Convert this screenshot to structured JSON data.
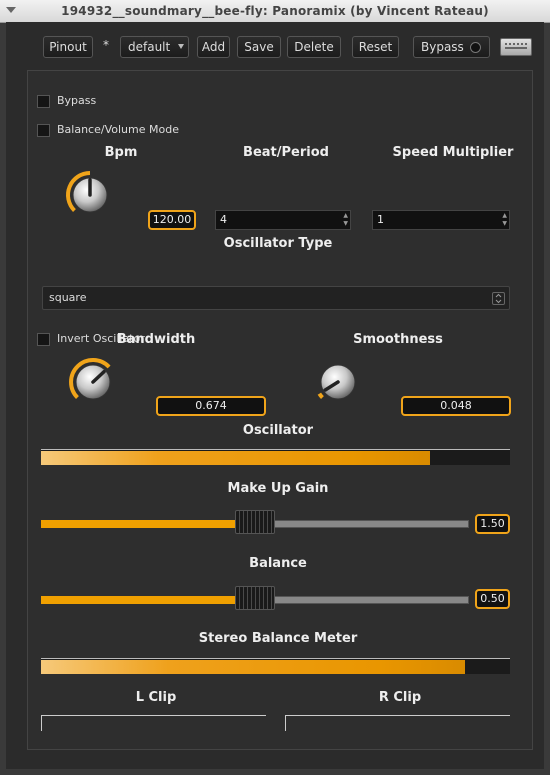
{
  "window": {
    "title": "194932__soundmary__bee-fly: Panoramix (by Vincent Rateau)"
  },
  "toolbar": {
    "pinout": "Pinout",
    "modified_marker": "*",
    "preset": "default",
    "add": "Add",
    "save": "Save",
    "delete": "Delete",
    "reset": "Reset",
    "bypass": "Bypass"
  },
  "controls": {
    "bypass_label": "Bypass",
    "bypass_checked": false,
    "balance_volume_mode_label": "Balance/Volume Mode",
    "balance_volume_mode_checked": false,
    "bpm_label": "Bpm",
    "bpm_value": "120.00",
    "bpm_level": 0.5,
    "beat_period_label": "Beat/Period",
    "beat_period_value": "4",
    "speed_multiplier_label": "Speed Multiplier",
    "speed_multiplier_value": "1",
    "oscillator_type_label": "Oscillator Type",
    "oscillator_type_value": "square",
    "invert_oscillator_label": "Invert Oscillator",
    "invert_oscillator_checked": false,
    "bandwidth_label": "Bandwidth",
    "bandwidth_value": "0.674",
    "bandwidth_level": 0.674,
    "smoothness_label": "Smoothness",
    "smoothness_value": "0.048",
    "smoothness_level": 0.048,
    "oscillator_label": "Oscillator",
    "oscillator_level": 0.83,
    "make_up_gain_label": "Make Up Gain",
    "make_up_gain_value": "1.50",
    "make_up_gain_level": 0.5,
    "balance_label": "Balance",
    "balance_value": "0.50",
    "balance_level": 0.5,
    "stereo_balance_meter_label": "Stereo Balance Meter",
    "stereo_balance_level": 0.905,
    "l_clip_label": "L Clip",
    "r_clip_label": "R Clip"
  },
  "colors": {
    "accent": "#f0a41a",
    "meter_fill": "#e99600"
  }
}
